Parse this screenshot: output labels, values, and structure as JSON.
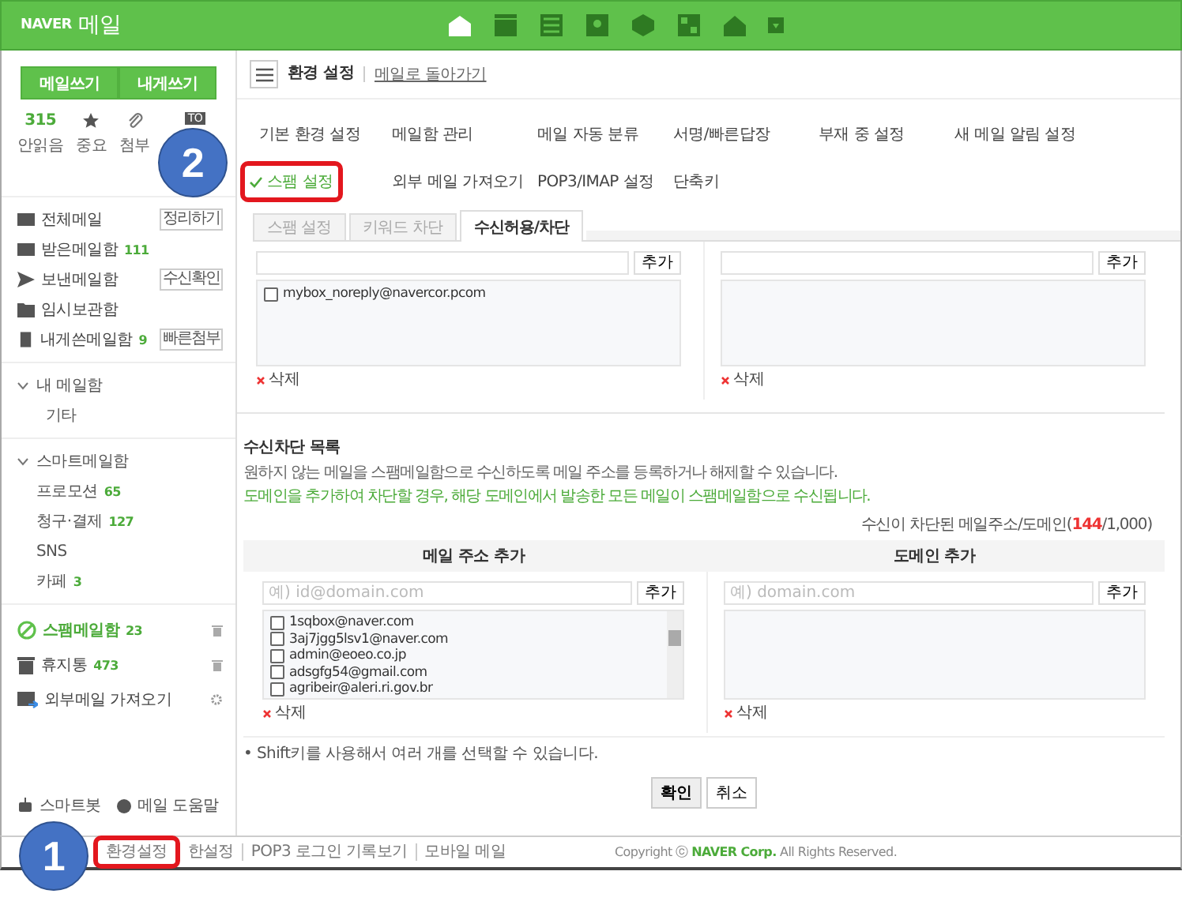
{
  "header": {
    "brand": "NAVER",
    "product": "메일"
  },
  "sidebar": {
    "write_buttons": [
      "메일쓰기",
      "내게쓰기"
    ],
    "quick": [
      {
        "kind": "count",
        "value": "315",
        "label": "안읽음"
      },
      {
        "kind": "star",
        "label": "중요"
      },
      {
        "kind": "clip",
        "label": "첨부"
      },
      {
        "kind": "tag",
        "value": "TO"
      }
    ],
    "folders": [
      {
        "kind": "all",
        "name": "전체메일",
        "action": "정리하기"
      },
      {
        "kind": "inbox",
        "name": "받은메일함",
        "count": "111"
      },
      {
        "kind": "sent",
        "name": "보낸메일함",
        "action": "수신확인"
      },
      {
        "kind": "draft",
        "name": "임시보관함"
      },
      {
        "kind": "self",
        "name": "내게쓴메일함",
        "count": "9",
        "action": "빠른첨부"
      }
    ],
    "groups": [
      {
        "title": "내 메일함",
        "expanded": true,
        "children": [
          {
            "name": "기타"
          }
        ]
      },
      {
        "title": "스마트메일함",
        "expanded": true,
        "children": [
          {
            "name": "프로모션",
            "count": "65"
          },
          {
            "name": "청구·결제",
            "count": "127"
          },
          {
            "name": "SNS"
          },
          {
            "name": "카페",
            "count": "3"
          }
        ]
      }
    ],
    "special": [
      {
        "kind": "spam",
        "name": "스팸메일함",
        "count": "23",
        "selected": true
      },
      {
        "kind": "trash",
        "name": "휴지통",
        "count": "473",
        "selected": false
      },
      {
        "kind": "external",
        "name": "외부메일 가져오기",
        "selected": false
      }
    ],
    "bottom": [
      "스마트봇",
      "메일 도움말"
    ]
  },
  "toolbar": {
    "title": "환경 설정",
    "link": "메일로 돌아가기"
  },
  "settings_menu": [
    {
      "label": "기본 환경 설정",
      "selected": false,
      "highlighted": false
    },
    {
      "label": "메일함 관리",
      "selected": false,
      "highlighted": false
    },
    {
      "label": "메일 자동 분류",
      "selected": false,
      "highlighted": false
    },
    {
      "label": "서명/빠른답장",
      "selected": false,
      "highlighted": false
    },
    {
      "label": "부재 중 설정",
      "selected": false,
      "highlighted": false
    },
    {
      "label": "새 메일 알림 설정",
      "selected": false,
      "highlighted": false
    },
    {
      "label": "스팸 설정",
      "selected": true,
      "highlighted": true
    },
    {
      "label": "외부 메일 가져오기",
      "selected": false,
      "highlighted": false
    },
    {
      "label": "POP3/IMAP 설정",
      "selected": false,
      "highlighted": false
    },
    {
      "label": "단축키",
      "selected": false,
      "highlighted": false
    }
  ],
  "tabs": [
    {
      "label": "스팸 설정",
      "selected": false
    },
    {
      "label": "키워드 차단",
      "selected": false
    },
    {
      "label": "수신허용/차단",
      "selected": true
    }
  ],
  "allow_panel": {
    "columns": [
      {
        "add_button": "추가",
        "items": [
          {
            "text": "mybox_noreply@navercor.pcom",
            "checked": false
          }
        ],
        "delete": "삭제"
      },
      {
        "add_button": "추가",
        "delete": "삭제"
      }
    ]
  },
  "block_section": {
    "title": "수신차단 목록",
    "description": "원하지 않는 메일을 스팸메일함으로 수신하도록 메일 주소를 등록하거나 해제할 수 있습니다.",
    "note": "도메인을 추가하여 차단할 경우, 해당 도메인에서 발송한 모든 메일이 스팸메일함으로 수신됩니다.",
    "counter_label": "수신이 차단된 메일주소/도메인(",
    "counter_value": "144",
    "counter_total": "/1,000)",
    "columns": [
      {
        "heading": "메일 주소 추가",
        "placeholder": "예) id@domain.com",
        "add_button": "추가",
        "delete": "삭제",
        "items": [
          {
            "text": "1sqbox@naver.com",
            "checked": false
          },
          {
            "text": "3aj7jgg5lsv1@naver.com",
            "checked": false
          },
          {
            "text": "admin@eoeo.co.jp",
            "checked": false
          },
          {
            "text": "adsgfg54@gmail.com",
            "checked": false
          },
          {
            "text": "agribeir@aleri.ri.gov.br",
            "checked": false
          }
        ]
      },
      {
        "heading": "도메인 추가",
        "placeholder": "예) domain.com",
        "add_button": "추가",
        "delete": "삭제"
      }
    ],
    "hint": "• Shift키를 사용해서 여러 개를 선택할 수 있습니다.",
    "buttons": [
      "확인",
      "취소"
    ]
  },
  "footer": {
    "links": [
      {
        "text": "환경설정",
        "highlighted": true
      },
      {
        "text": "한설정",
        "highlighted": false
      },
      {
        "text": "POP3 로그인 기록보기",
        "highlighted": false
      },
      {
        "text": "모바일 메일",
        "highlighted": false
      }
    ],
    "copyright_prefix": "Copyright ⓒ",
    "company": "NAVER Corp.",
    "copyright_suffix": "All Rights Reserved."
  },
  "annotations": [
    {
      "label": "2"
    },
    {
      "label": "1"
    }
  ]
}
